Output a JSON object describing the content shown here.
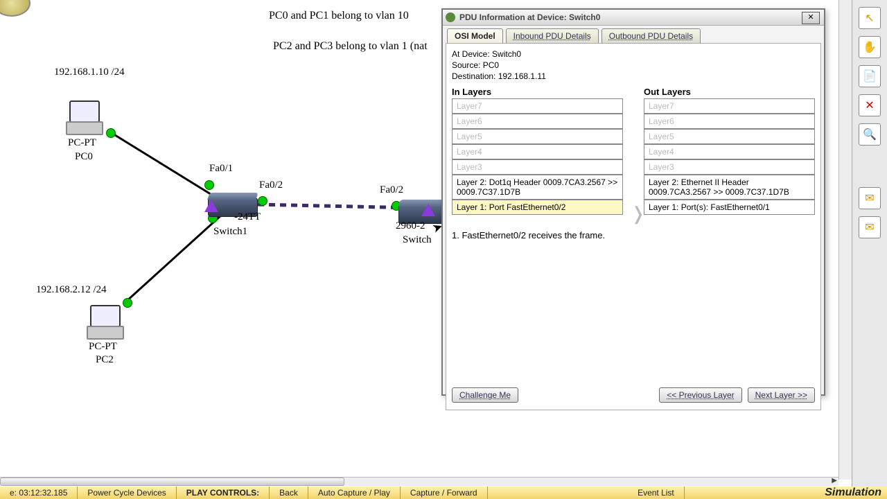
{
  "topology": {
    "notes": {
      "vlan10": "PC0 and PC1 belong to vlan 10",
      "vlan1": "PC2 and PC3 belong to vlan 1 (nat"
    },
    "pc0": {
      "ip": "192.168.1.10 /24",
      "type": "PC-PT",
      "name": "PC0"
    },
    "pc2": {
      "ip": "192.168.2.12 /24",
      "type": "PC-PT",
      "name": "PC2"
    },
    "switch1": {
      "model": "-24TT",
      "name": "Switch1"
    },
    "switch0": {
      "model": "2960-2",
      "name": "Switch"
    },
    "ports": {
      "sw1_fa01": "Fa0/1",
      "sw1_fa02": "Fa0/2",
      "sw0_fa02": "Fa0/2"
    }
  },
  "pdu_window": {
    "title": "PDU Information at Device: Switch0",
    "tabs": {
      "osi": "OSI Model",
      "inbound": "Inbound PDU Details",
      "outbound": "Outbound PDU Details"
    },
    "meta": {
      "device": "At Device: Switch0",
      "source": "Source: PC0",
      "dest": "Destination: 192.168.1.11"
    },
    "in_header": "In Layers",
    "out_header": "Out Layers",
    "layers_disabled": {
      "l7": "Layer7",
      "l6": "Layer6",
      "l5": "Layer5",
      "l4": "Layer4",
      "l3": "Layer3"
    },
    "in_l2": "Layer 2: Dot1q Header 0009.7CA3.2567 >> 0009.7C37.1D7B",
    "in_l1": "Layer 1: Port FastEthernet0/2",
    "out_l2": "Layer 2: Ethernet II Header 0009.7CA3.2567 >> 0009.7C37.1D7B",
    "out_l1": "Layer 1: Port(s): FastEthernet0/1",
    "process": "1. FastEthernet0/2 receives the frame.",
    "buttons": {
      "challenge": "Challenge Me",
      "prev": "<< Previous Layer",
      "next": "Next Layer >>"
    }
  },
  "right_tools": {
    "select": "↖",
    "hand": "✋",
    "note": "📄",
    "delete": "✕",
    "inspect": "🔍",
    "env_open": "✉",
    "env_closed": "✉"
  },
  "status": {
    "time": "e: 03:12:32.185",
    "power": "Power Cycle Devices",
    "play_label": "PLAY CONTROLS:",
    "back": "Back",
    "auto": "Auto Capture / Play",
    "capfwd": "Capture / Forward",
    "eventlist": "Event List",
    "mode": "Simulation"
  }
}
